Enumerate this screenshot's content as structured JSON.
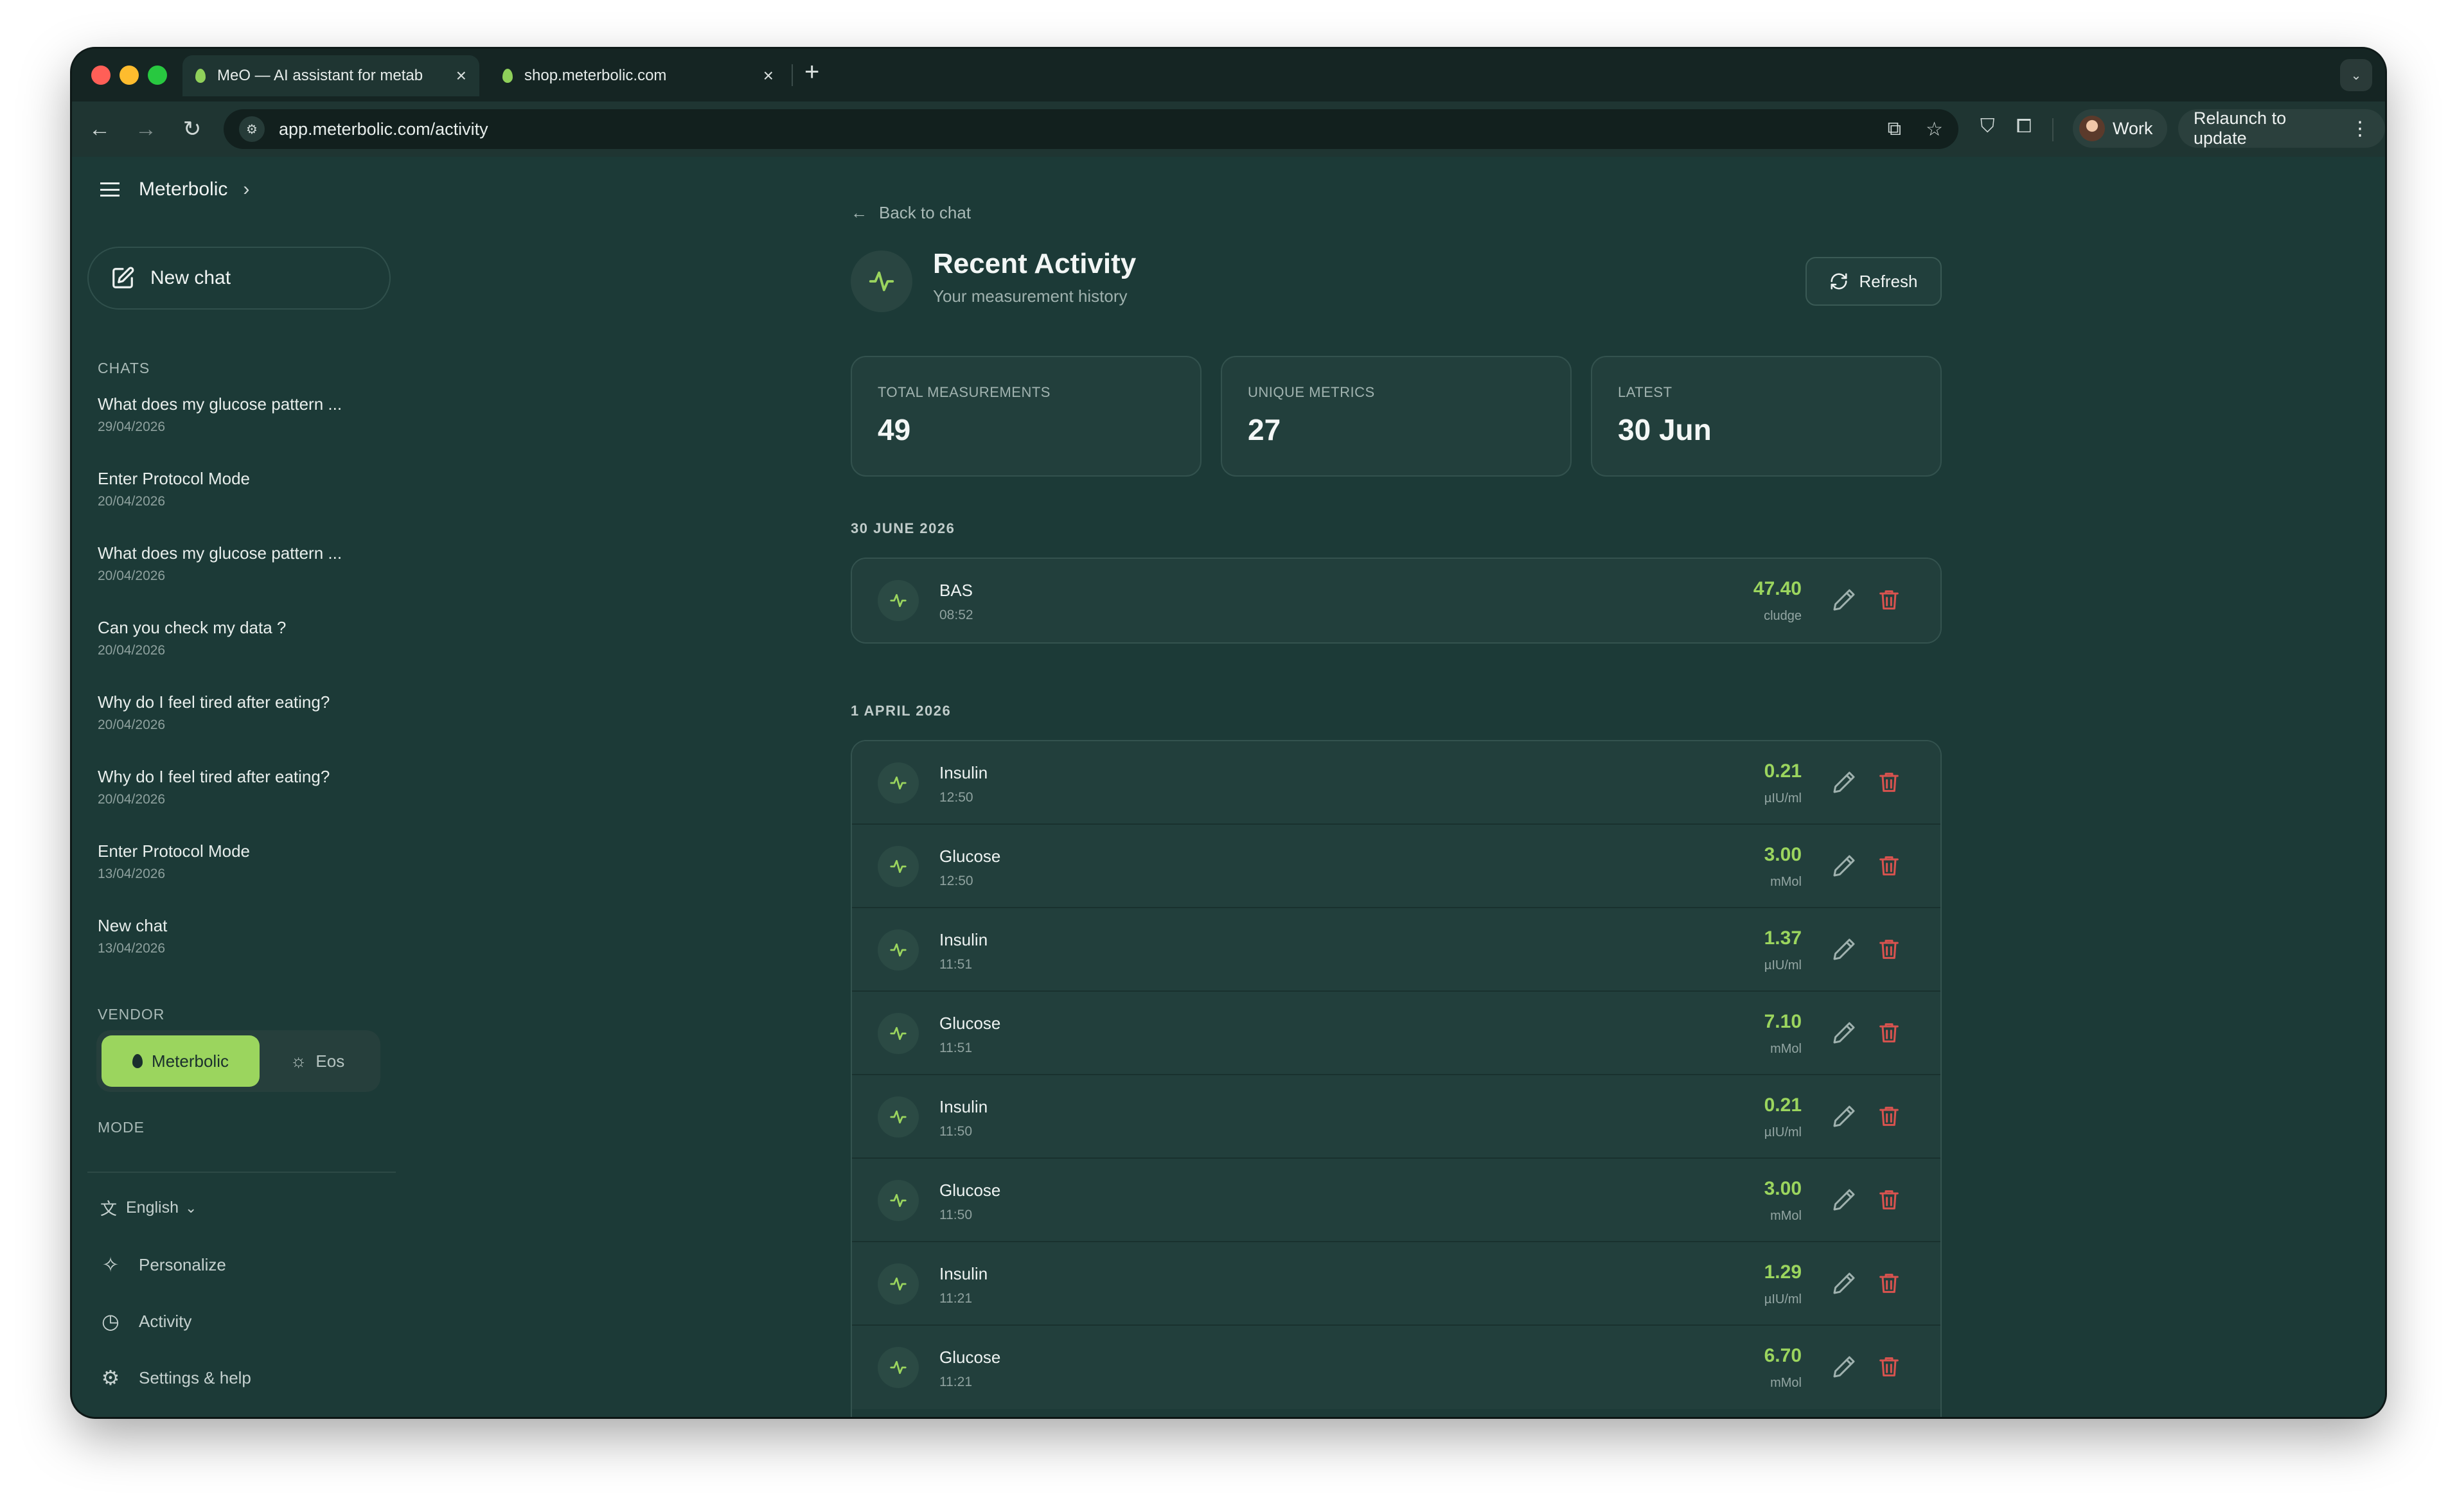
{
  "browser": {
    "tabs": [
      {
        "title": "MeO — AI assistant for metab",
        "active": true
      },
      {
        "title": "shop.meterbolic.com",
        "active": false
      }
    ],
    "url": "app.meterbolic.com/activity",
    "profile_label": "Work",
    "relaunch_label": "Relaunch to update"
  },
  "sidebar": {
    "brand": "Meterbolic",
    "new_chat_label": "New chat",
    "chats_label": "CHATS",
    "chats": [
      {
        "title": "What does my glucose pattern ...",
        "date": "29/04/2026"
      },
      {
        "title": "Enter Protocol Mode",
        "date": "20/04/2026"
      },
      {
        "title": "What does my glucose pattern ...",
        "date": "20/04/2026"
      },
      {
        "title": "Can you check my data ?",
        "date": "20/04/2026"
      },
      {
        "title": "Why do I feel tired after eating?",
        "date": "20/04/2026"
      },
      {
        "title": "Why do I feel tired after eating?",
        "date": "20/04/2026"
      },
      {
        "title": "Enter Protocol Mode",
        "date": "13/04/2026"
      },
      {
        "title": "New chat",
        "date": "13/04/2026"
      }
    ],
    "vendor_label": "VENDOR",
    "vendors": [
      {
        "label": "Meterbolic",
        "selected": true
      },
      {
        "label": "Eos",
        "selected": false
      }
    ],
    "mode_label": "MODE",
    "language": "English",
    "links": {
      "personalize": "Personalize",
      "activity": "Activity",
      "settings": "Settings & help"
    }
  },
  "main": {
    "back_label": "Back to chat",
    "title": "Recent Activity",
    "subtitle": "Your measurement history",
    "refresh_label": "Refresh",
    "stats": [
      {
        "label": "TOTAL MEASUREMENTS",
        "value": "49"
      },
      {
        "label": "UNIQUE METRICS",
        "value": "27"
      },
      {
        "label": "LATEST",
        "value": "30 Jun"
      }
    ],
    "groups": [
      {
        "date": "30 JUNE 2026",
        "rows": [
          {
            "name": "BAS",
            "time": "08:52",
            "value": "47.40",
            "unit": "cludge"
          }
        ]
      },
      {
        "date": "1 APRIL 2026",
        "rows": [
          {
            "name": "Insulin",
            "time": "12:50",
            "value": "0.21",
            "unit": "µIU/ml"
          },
          {
            "name": "Glucose",
            "time": "12:50",
            "value": "3.00",
            "unit": "mMol"
          },
          {
            "name": "Insulin",
            "time": "11:51",
            "value": "1.37",
            "unit": "µIU/ml"
          },
          {
            "name": "Glucose",
            "time": "11:51",
            "value": "7.10",
            "unit": "mMol"
          },
          {
            "name": "Insulin",
            "time": "11:50",
            "value": "0.21",
            "unit": "µIU/ml"
          },
          {
            "name": "Glucose",
            "time": "11:50",
            "value": "3.00",
            "unit": "mMol"
          },
          {
            "name": "Insulin",
            "time": "11:21",
            "value": "1.29",
            "unit": "µIU/ml"
          },
          {
            "name": "Glucose",
            "time": "11:21",
            "value": "6.70",
            "unit": "mMol"
          }
        ]
      }
    ]
  },
  "colors": {
    "accent": "#9bd55e",
    "delete": "#d9534f",
    "background": "#1c3a37"
  }
}
